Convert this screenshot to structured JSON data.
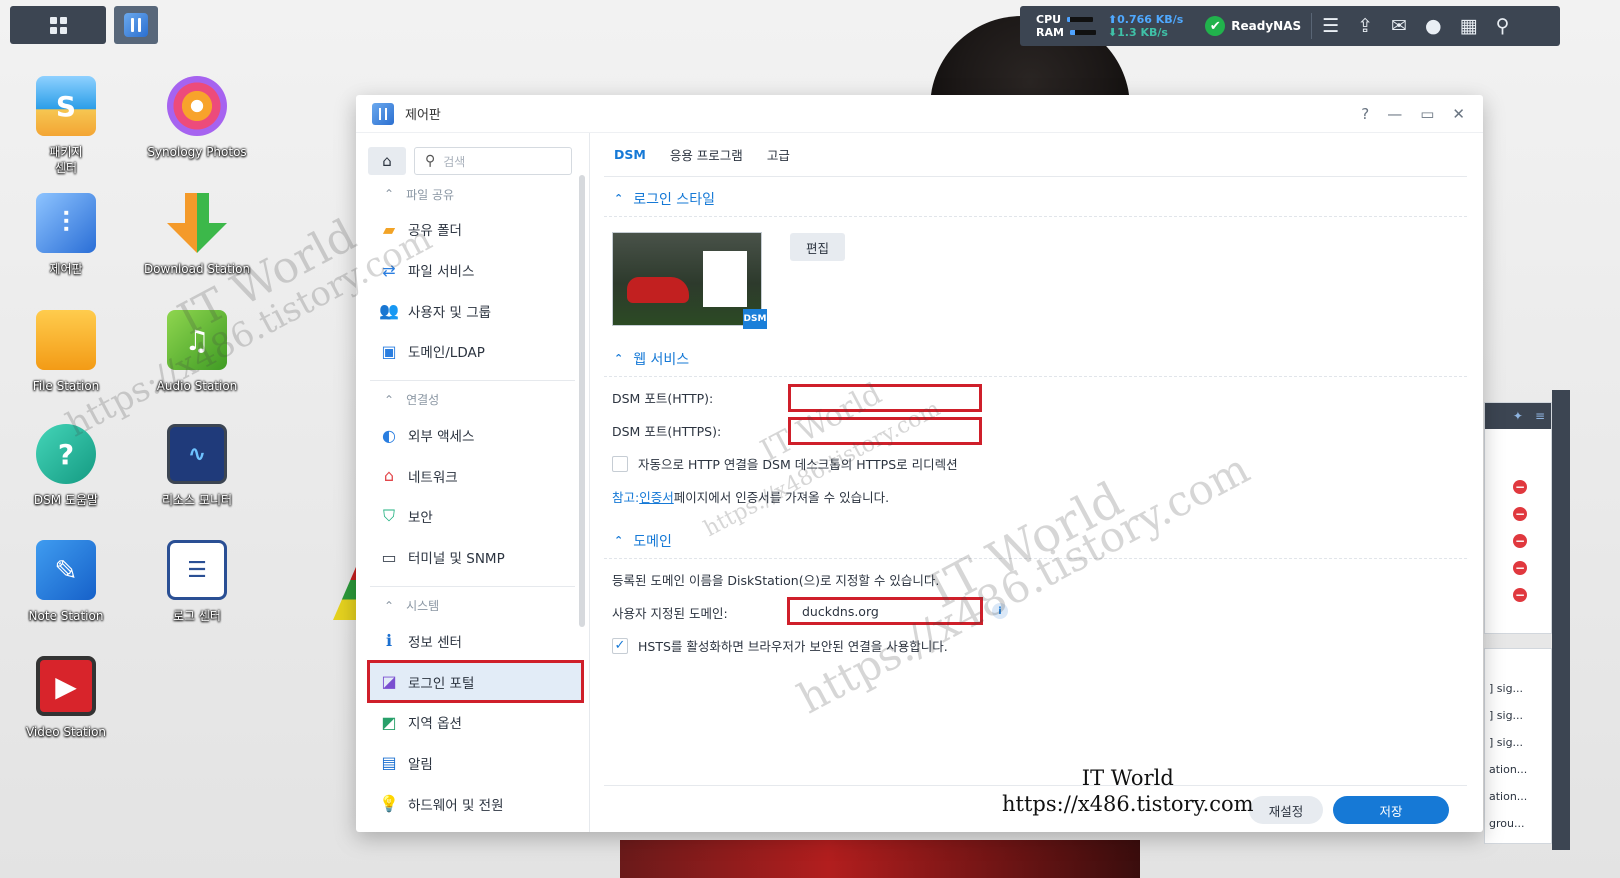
{
  "taskbar": {
    "cpu_label": "CPU",
    "ram_label": "RAM",
    "cpu_usage": 0.12,
    "ram_usage": 0.2,
    "upload": "0.766 KB/s",
    "download": "1.3 KB/s",
    "server_name": "ReadyNAS",
    "icons": [
      "grid-icon",
      "storage-icon",
      "upload-icon",
      "chat-icon",
      "user-icon",
      "widget-icon",
      "search-icon"
    ]
  },
  "desktop": {
    "icons": [
      {
        "label": "패키지\n센터",
        "name": "package-center"
      },
      {
        "label": "Synology Photos",
        "name": "synology-photos"
      },
      {
        "label": "제어판",
        "name": "control-panel"
      },
      {
        "label": "Download Station",
        "name": "download-station"
      },
      {
        "label": "File Station",
        "name": "file-station"
      },
      {
        "label": "Audio Station",
        "name": "audio-station"
      },
      {
        "label": "DSM 도움말",
        "name": "dsm-help"
      },
      {
        "label": "리소스 모니터",
        "name": "resource-monitor"
      },
      {
        "label": "Note Station",
        "name": "note-station"
      },
      {
        "label": "로그 센터",
        "name": "log-center"
      },
      {
        "label": "Video Station",
        "name": "video-station"
      }
    ]
  },
  "window": {
    "title": "제어판",
    "search_placeholder": "검색",
    "sidebar": {
      "sections": [
        {
          "title": "파일 공유",
          "items": [
            "공유 폴더",
            "파일 서비스",
            "사용자 및 그룹",
            "도메인/LDAP"
          ]
        },
        {
          "title": "연결성",
          "items": [
            "외부 액세스",
            "네트워크",
            "보안",
            "터미널 및 SNMP"
          ]
        },
        {
          "title": "시스템",
          "items": [
            "정보 센터",
            "로그인 포털",
            "지역 옵션",
            "알림",
            "하드웨어 및 전원"
          ]
        }
      ],
      "active_item": "로그인 포털"
    },
    "tabs": [
      "DSM",
      "응용 프로그램",
      "고급"
    ],
    "active_tab": "DSM",
    "login_style": {
      "title": "로그인 스타일",
      "edit_button": "편집",
      "preview_badge": "DSM"
    },
    "web_service": {
      "title": "웹 서비스",
      "http_label": "DSM 포트(HTTP):",
      "http_value": "",
      "https_label": "DSM 포트(HTTPS):",
      "https_value": "",
      "redirect_label": "자동으로 HTTP 연결을 DSM 데스크톱의 HTTPS로 리디렉션",
      "redirect_checked": false,
      "note_prefix": "참고: ",
      "note_link": "인증서",
      "note_suffix": " 페이지에서 인증서를 가져올 수 있습니다."
    },
    "domain": {
      "title": "도메인",
      "description": "등록된 도메인 이름을 DiskStation(으)로 지정할 수 있습니다.",
      "custom_label": "사용자 지정된 도메인:",
      "custom_value": "duckdns.org",
      "hsts_label": "HSTS를 활성화하면 브라우저가 보안된 연결을 사용합니다.",
      "hsts_checked": true
    },
    "buttons": {
      "reset": "재설정",
      "save": "저장"
    }
  },
  "log_panel": {
    "rows": [
      "] sig...",
      "] sig...",
      "] sig...",
      "ation...",
      "ation...",
      "grou..."
    ]
  },
  "watermark": {
    "line1": "IT World",
    "line2": "https://x486.tistory.com"
  }
}
